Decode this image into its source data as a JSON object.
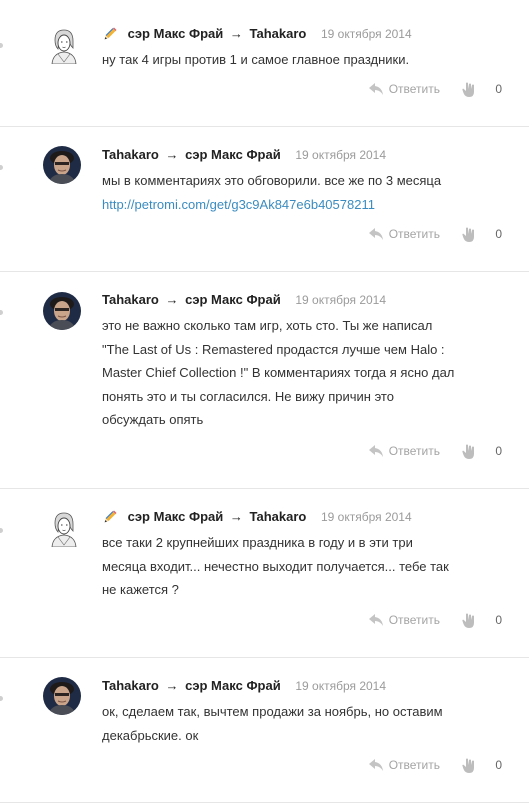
{
  "comments": [
    {
      "author": "сэр Макс Фрай",
      "arrow": "→",
      "recipient": "Tahakaro",
      "date": "19 октября 2014",
      "edited": true,
      "avatar": "sketch-portrait",
      "lines": [
        "ну так 4 игры против 1 и самое главное праздники."
      ],
      "link": "",
      "reply_label": "Ответить",
      "likes": "0"
    },
    {
      "author": "Tahakaro",
      "arrow": "→",
      "recipient": "сэр Макс Фрай",
      "date": "19 октября 2014",
      "edited": false,
      "avatar": "photo-portrait",
      "lines": [
        "мы в комментариях это обговорили. все же по 3 месяца"
      ],
      "link": "http://petromi.com/get/g3c9Ak847e6b40578211",
      "reply_label": "Ответить",
      "likes": "0"
    },
    {
      "author": "Tahakaro",
      "arrow": "→",
      "recipient": "сэр Макс Фрай",
      "date": "19 октября 2014",
      "edited": false,
      "avatar": "photo-portrait",
      "lines": [
        "это не важно сколько там игр, хоть сто. Ты же написал",
        "\"The Last of Us : Remastered продастся лучше чем Halo :",
        "Master Chief Collection !\" В комментариях тогда я ясно дал",
        "понять это и ты согласился. Не вижу причин это",
        "обсуждать опять"
      ],
      "link": "",
      "reply_label": "Ответить",
      "likes": "0"
    },
    {
      "author": "сэр Макс Фрай",
      "arrow": "→",
      "recipient": "Tahakaro",
      "date": "19 октября 2014",
      "edited": true,
      "avatar": "sketch-portrait",
      "lines": [
        "все таки 2 крупнейших праздника в году и в эти три",
        "месяца входит... нечестно выходит получается... тебе так",
        "не кажется ?"
      ],
      "link": "",
      "reply_label": "Ответить",
      "likes": "0"
    },
    {
      "author": "Tahakaro",
      "arrow": "→",
      "recipient": "сэр Макс Фрай",
      "date": "19 октября 2014",
      "edited": false,
      "avatar": "photo-portrait",
      "lines": [
        "ок, сделаем так, вычтем продажи за ноябрь, но оставим",
        "декабрьские. ок"
      ],
      "link": "",
      "reply_label": "Ответить",
      "likes": "0"
    }
  ],
  "icons": {
    "reply": "reply-arrow-icon",
    "like": "thumb-hand-icon",
    "edit": "pencil-icon"
  },
  "colors": {
    "link": "#3a8cc0",
    "date": "#9b9b9b",
    "action": "#a4a4a4",
    "separator": "#e6e6e6"
  }
}
